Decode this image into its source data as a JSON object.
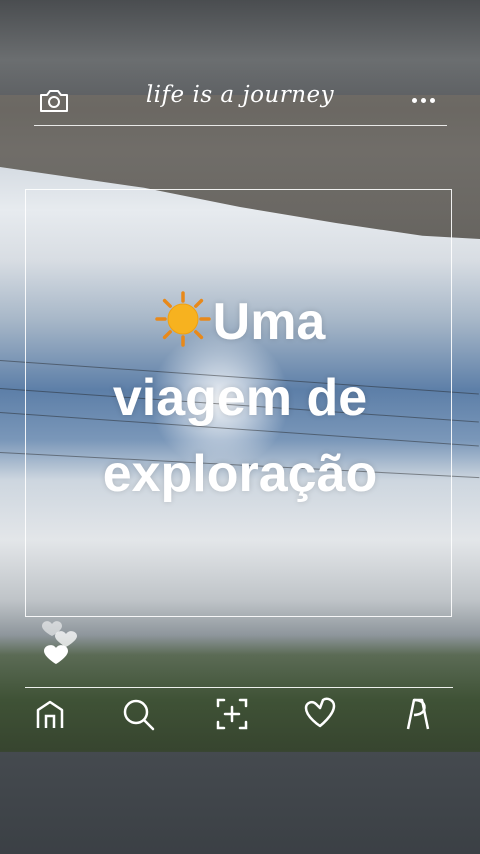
{
  "header": {
    "title": "life is a journey",
    "camera_icon": "camera-icon",
    "more_icon": "more-dots-icon"
  },
  "post": {
    "emoji": "sun-emoji",
    "headline_lines": [
      "Uma",
      "viagem de",
      "exploração"
    ]
  },
  "reactions": {
    "icon": "hearts-icon"
  },
  "bottom_nav": {
    "items": [
      {
        "icon": "home-icon"
      },
      {
        "icon": "search-icon"
      },
      {
        "icon": "add-post-icon"
      },
      {
        "icon": "heart-icon"
      },
      {
        "icon": "profile-icon"
      }
    ]
  },
  "colors": {
    "foreground": "#ffffff",
    "sky": "#5d7fa8",
    "sun": "#f7b21f"
  }
}
